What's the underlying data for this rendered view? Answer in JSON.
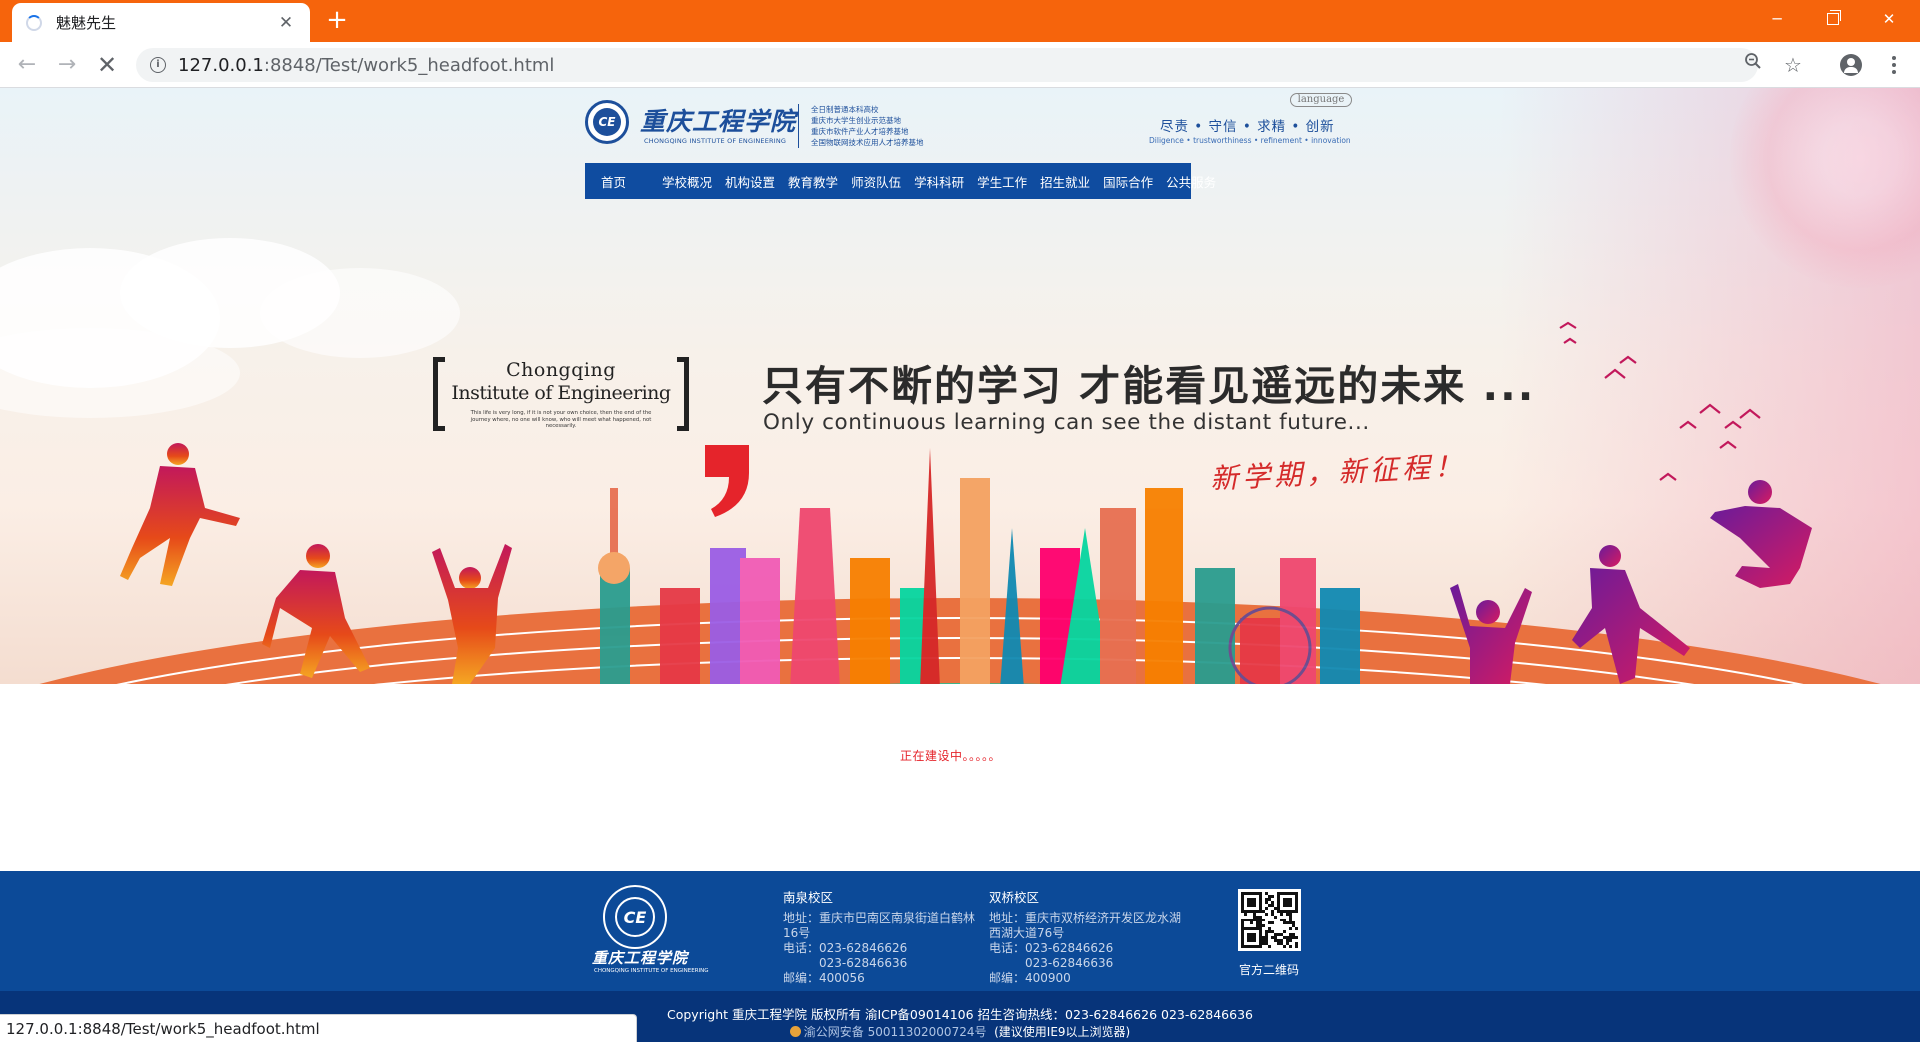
{
  "browser": {
    "tab_title": "魅魅先生",
    "tab_close": "✕",
    "new_tab": "+",
    "window_minimize": "─",
    "window_close": "✕",
    "url_host": "127.0.0.1",
    "url_path": ":8848/Test/work5_headfoot.html",
    "status_url": "127.0.0.1:8848/Test/work5_headfoot.html",
    "icons": {
      "back": "arrow-left-icon",
      "forward": "arrow-right-icon",
      "stop": "close-icon",
      "info": "info-icon",
      "zoom": "zoom-out-icon",
      "bookmark": "star-icon",
      "profile": "account-icon",
      "menu": "more-vertical-icon"
    },
    "colors": {
      "titlebar": "#f6640c",
      "omnibox": "#f1f3f4"
    }
  },
  "header": {
    "school_name_cn": "重庆工程学院",
    "school_name_en": "CHONGQING INSTITUTE OF ENGINEERING",
    "honors": [
      "全日制普通本科高校",
      "重庆市大学生创业示范基地",
      "重庆市软件产业人才培养基地",
      "全国物联网技术应用人才培养基地"
    ],
    "language_button": "language",
    "motto_cn": "尽责 • 守信 • 求精 • 创新",
    "motto_en": "Diligence • trustworthiness • refinement • innovation",
    "nav": [
      "首页",
      "学校概况",
      "机构设置",
      "教育教学",
      "师资队伍",
      "学科科研",
      "学生工作",
      "招生就业",
      "国际合作",
      "公共服务"
    ],
    "colors": {
      "brand_blue": "#0f4ca0"
    }
  },
  "banner": {
    "brand_line1": "Chongqing",
    "brand_line2": "Institute of Engineering",
    "brand_small": "This life is very long, if it is not your own choice, then the end of the journey where, no one will know, who will meet what happened, not necessarily.",
    "slogan_cn": "只有不断的学习  才能看见遥远的未来 ...",
    "slogan_en": "Only continuous learning can see the distant future...",
    "new_term": "新学期，新征程！"
  },
  "main": {
    "construction_notice": "正在建设中。。。。。"
  },
  "footer": {
    "logo_cn": "重庆工程学院",
    "logo_en": "CHONGQING INSTITUTE OF ENGINEERING",
    "campus_nanquan": {
      "title": "南泉校区",
      "address": "地址：重庆市巴南区南泉街道白鹤林16号",
      "phone1": "电话：023-62846626",
      "phone2": "023-62846636",
      "postcode": "邮编：400056"
    },
    "campus_shuangqiao": {
      "title": "双桥校区",
      "address": "地址：重庆市双桥经济开发区龙水湖西湖大道76号",
      "phone1": "电话：023-62846626",
      "phone2": "023-62846636",
      "postcode": "邮编：400900"
    },
    "qr_label": "官方二维码",
    "copyright": "Copyright 重庆工程学院 版权所有 渝ICP备09014106 招生咨询热线：023-62846626 023-62846636",
    "beian_id": "渝公网安备 50011302000724号",
    "browser_tip": "(建议使用IE9以上浏览器)",
    "colors": {
      "footer_blue": "#0c4a98",
      "footer_dark": "#07347a"
    }
  }
}
